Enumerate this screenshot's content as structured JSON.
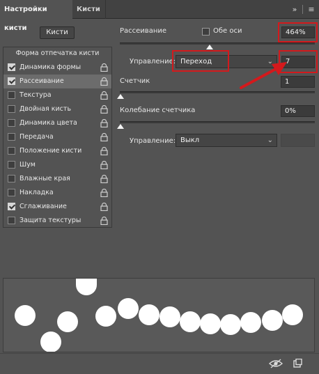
{
  "tabs": [
    {
      "label": "Настройки кисти",
      "active": true
    },
    {
      "label": "Кисти",
      "active": false
    }
  ],
  "toolbar": {
    "collapse_icon": "double-chevron-right-icon",
    "menu_icon": "hamburger-menu-icon"
  },
  "brushes_button": {
    "label": "Кисти"
  },
  "left_panel": {
    "header": "Форма отпечатка кисти",
    "items": [
      {
        "label": "Динамика формы",
        "checked": true,
        "selected": false
      },
      {
        "label": "Рассеивание",
        "checked": true,
        "selected": true
      },
      {
        "label": "Текстура",
        "checked": false,
        "selected": false
      },
      {
        "label": "Двойная кисть",
        "checked": false,
        "selected": false
      },
      {
        "label": "Динамика цвета",
        "checked": false,
        "selected": false
      },
      {
        "label": "Передача",
        "checked": false,
        "selected": false
      },
      {
        "label": "Положение кисти",
        "checked": false,
        "selected": false
      },
      {
        "label": "Шум",
        "checked": false,
        "selected": false
      },
      {
        "label": "Влажные края",
        "checked": false,
        "selected": false
      },
      {
        "label": "Накладка",
        "checked": false,
        "selected": false
      },
      {
        "label": "Сглаживание",
        "checked": true,
        "selected": false
      },
      {
        "label": "Защита текстуры",
        "checked": false,
        "selected": false
      }
    ]
  },
  "scatter": {
    "label": "Рассеивание",
    "both_axes_label": "Обе оси",
    "both_axes_checked": false,
    "value": "464%",
    "control_label": "Управление:",
    "control_value": "Переход",
    "fade_value": "7"
  },
  "count": {
    "label": "Счетчик",
    "value": "1"
  },
  "count_jitter": {
    "label": "Колебание счетчика",
    "value": "0%",
    "control_label": "Управление:",
    "control_value": "Выкл"
  },
  "annotation": {
    "color": "#d4191c"
  },
  "bottom_icons": {
    "left": "eye-toggle-icon",
    "right": "new-brush-icon"
  }
}
